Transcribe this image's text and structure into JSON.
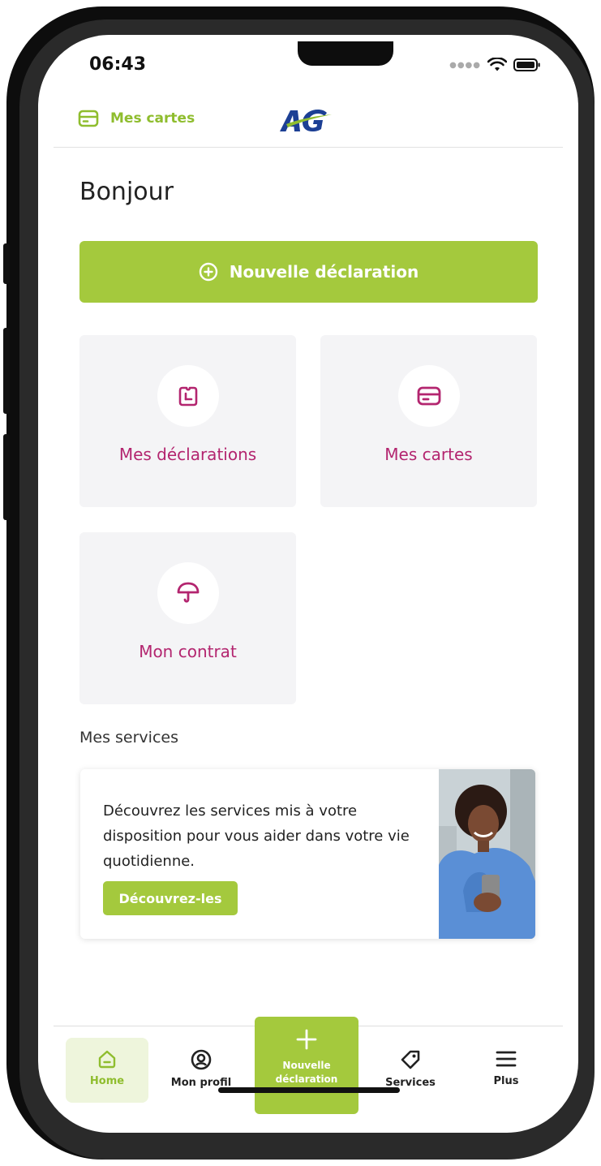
{
  "status_bar": {
    "time": "06:43"
  },
  "top_bar": {
    "cards_label": "Mes cartes",
    "logo_text": "AG"
  },
  "greeting": "Bonjour",
  "cta": {
    "label": "Nouvelle déclaration"
  },
  "tiles": [
    {
      "label": "Mes déclarations",
      "icon": "claims-document-icon"
    },
    {
      "label": "Mes cartes",
      "icon": "credit-card-icon"
    },
    {
      "label": "Mon contrat",
      "icon": "umbrella-icon"
    }
  ],
  "services": {
    "section_title": "Mes services",
    "promo_text": "Découvrez les services mis à votre disposition pour vous aider dans votre vie quotidienne.",
    "promo_button": "Découvrez-les"
  },
  "bottom_nav": {
    "items": [
      {
        "label": "Home",
        "icon": "home-icon",
        "active": true
      },
      {
        "label": "Mon profil",
        "icon": "profile-icon"
      },
      {
        "label": "Nouvelle déclaration",
        "icon": "plus-icon"
      },
      {
        "label": "Services",
        "icon": "tag-icon"
      },
      {
        "label": "Plus",
        "icon": "menu-icon"
      }
    ]
  },
  "colors": {
    "brand_green": "#a4c93d",
    "label_green": "#8fbd2e",
    "tile_text": "#b3256f",
    "tile_bg": "#f4f4f6"
  }
}
